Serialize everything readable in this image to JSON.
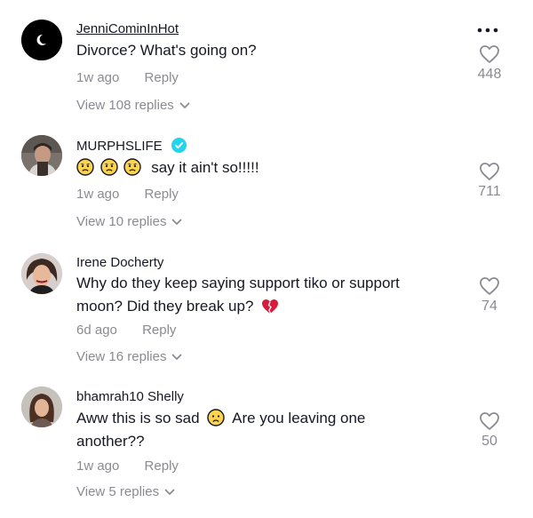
{
  "comments": [
    {
      "username": "JenniCominInHot",
      "text": "Divorce? What's going on?",
      "time": "1w ago",
      "reply_label": "Reply",
      "view_replies": "View 108 replies",
      "likes": "448",
      "avatar": "moon-avatar"
    },
    {
      "username": "MURPHSLIFE",
      "verified": true,
      "text": "say it ain't so!!!!!",
      "emojis": [
        "worried-face",
        "worried-face",
        "worried-face"
      ],
      "time": "1w ago",
      "reply_label": "Reply",
      "view_replies": "View 10 replies",
      "likes": "711",
      "avatar": "person-avatar"
    },
    {
      "username": "Irene Docherty",
      "text_line1": "Why do they keep saying support tiko or support",
      "text_line2": "moon? Did they break up?",
      "emoji": "broken-heart",
      "time": "6d ago",
      "reply_label": "Reply",
      "view_replies": "View 16 replies",
      "likes": "74",
      "avatar": "person-avatar"
    },
    {
      "username": "bhamrah10 Shelly",
      "text_before": "Aww this is so sad",
      "emoji": "frowning-face",
      "text_after": "Are you leaving one",
      "text_line2": "another??",
      "time": "1w ago",
      "reply_label": "Reply",
      "view_replies": "View 5 replies",
      "likes": "50",
      "avatar": "person-avatar"
    }
  ],
  "colors": {
    "text": "#161823",
    "muted": "#8a8b91",
    "verified": "#20d5ec",
    "heart": "#d81b3c"
  }
}
